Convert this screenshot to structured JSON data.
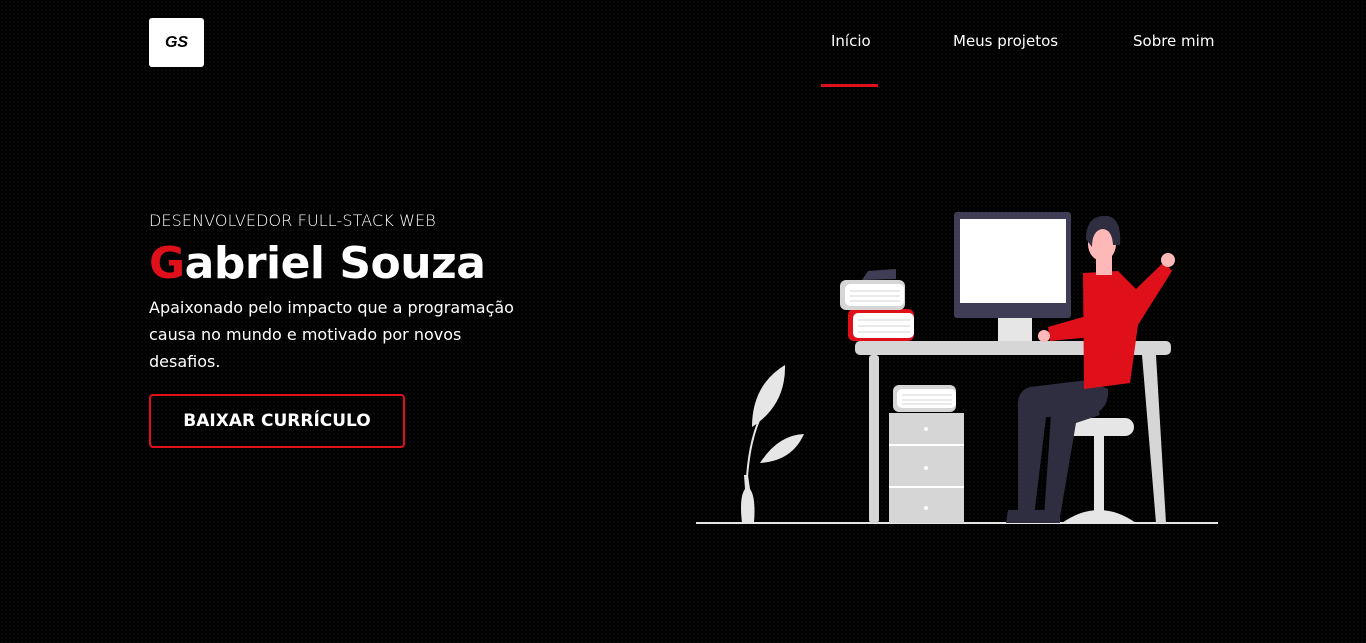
{
  "header": {
    "logo_text": "GS",
    "nav": [
      {
        "label": "Início",
        "active": true
      },
      {
        "label": "Meus projetos",
        "active": false
      },
      {
        "label": "Sobre mim",
        "active": false
      }
    ]
  },
  "hero": {
    "kicker": "DESENVOLVEDOR FULL-STACK WEB",
    "name_first_letter": "G",
    "name_rest": "abriel Souza",
    "description": "Apaixonado pelo impacto que a programação causa no mundo e motivado por novos desafios.",
    "cv_button_label": "BAIXAR CURRÍCULO"
  },
  "colors": {
    "accent": "#e0101a",
    "background": "#000000",
    "text": "#ffffff"
  },
  "illustration": {
    "icon": "developer-at-desk-illustration"
  }
}
